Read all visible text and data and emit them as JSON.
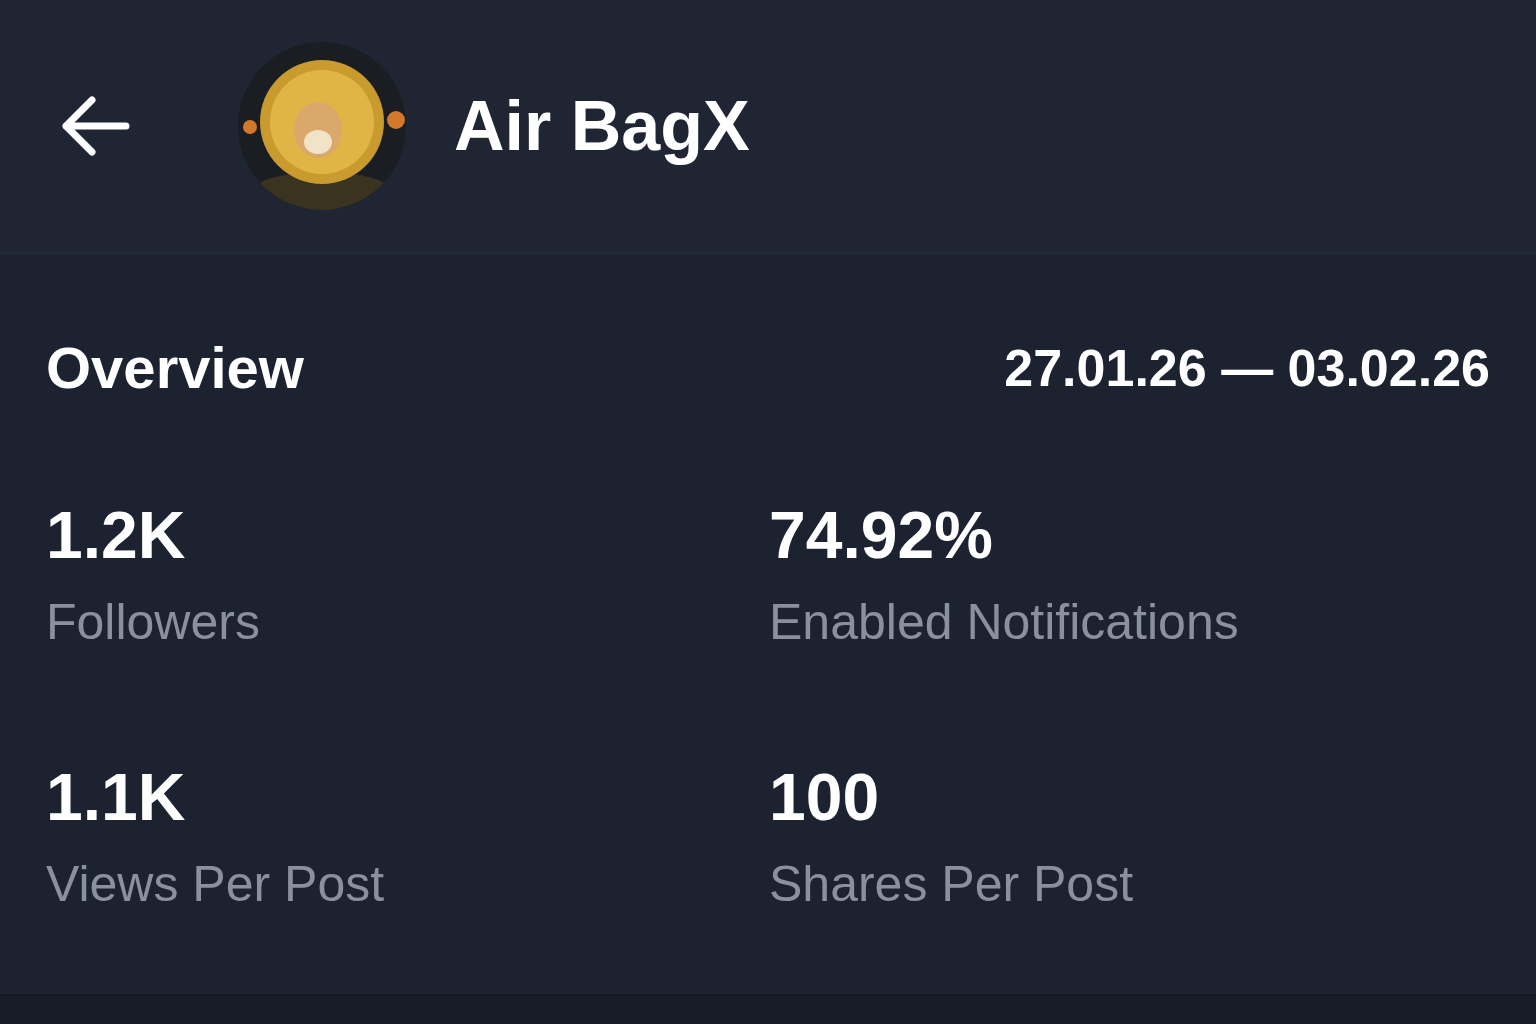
{
  "header": {
    "title": "Air BagX"
  },
  "overview": {
    "title": "Overview",
    "date_range": "27.01.26 — 03.02.26"
  },
  "stats": [
    {
      "value": "1.2K",
      "label": "Followers"
    },
    {
      "value": "74.92%",
      "label": "Enabled Notifications"
    },
    {
      "value": "1.1K",
      "label": "Views Per Post"
    },
    {
      "value": "100",
      "label": "Shares Per Post"
    }
  ]
}
